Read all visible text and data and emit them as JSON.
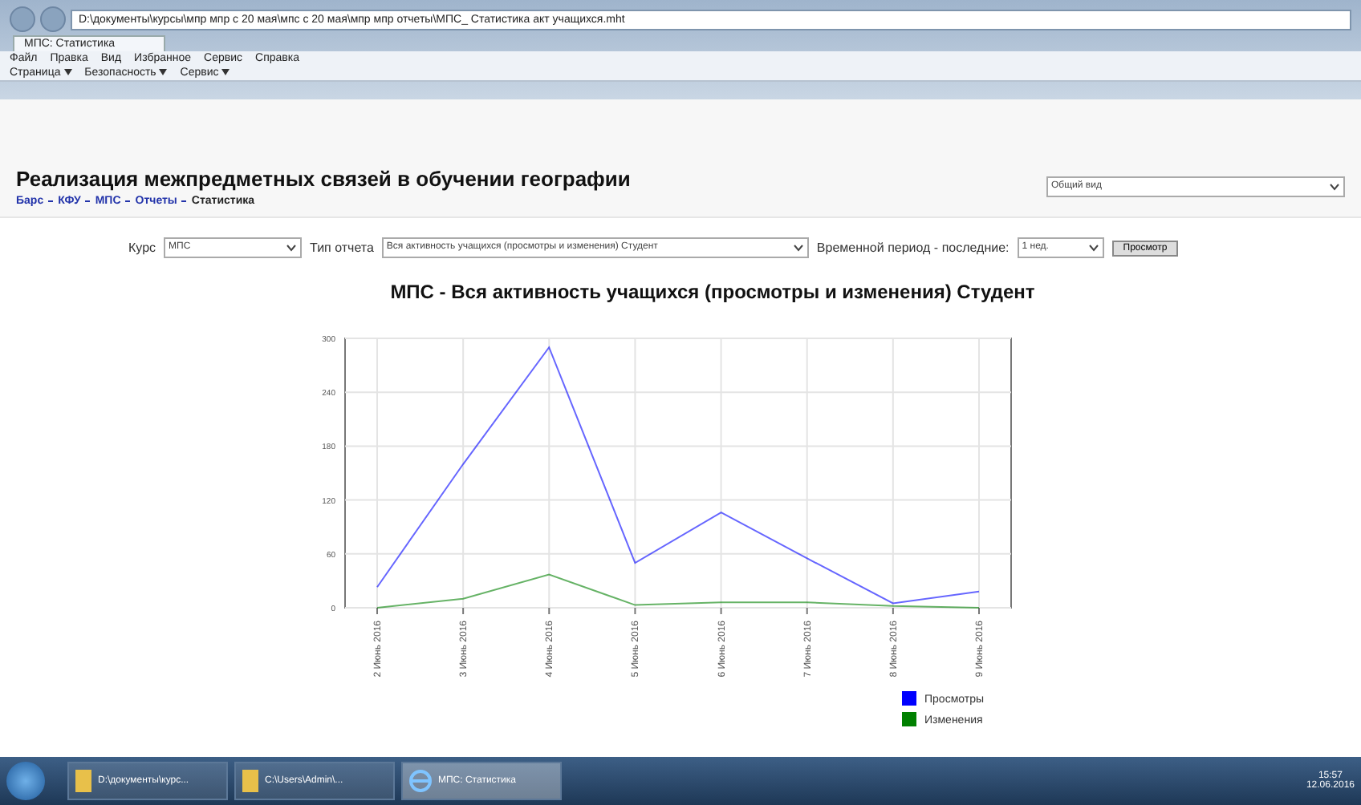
{
  "browser": {
    "address": "D:\\документы\\курсы\\мпр мпр с 20 мая\\мпс с 20 мая\\мпр мпр отчеты\\МПС_ Статистика акт учащихся.mht",
    "tab": "МПС: Статистика",
    "menu": [
      "Файл",
      "Правка",
      "Вид",
      "Избранное",
      "Сервис",
      "Справка"
    ],
    "commands": [
      "Страница",
      "Безопасность",
      "Сервис"
    ]
  },
  "page": {
    "title": "Реализация межпредметных связей в обучении географии",
    "view_select": "Общий вид",
    "breadcrumbs": [
      "Барс",
      "КФУ",
      "МПС",
      "Отчеты",
      "Статистика"
    ]
  },
  "filters": [
    {
      "label": "Курс",
      "value": "МПС",
      "kind": "select"
    },
    {
      "label": "Тип отчета",
      "value": "Вся активность учащихся (просмотры и изменения) Студент",
      "kind": "select"
    },
    {
      "label": "Временной период - последние:",
      "value": "1 нед.",
      "kind": "select"
    },
    {
      "label": "Просмотр",
      "kind": "button"
    }
  ],
  "report": {
    "title": "МПС - Вся активность учащихся (просмотры и изменения) Студент",
    "chart_data": {
      "type": "line",
      "grid": true,
      "legend": true,
      "categories": [
        "2 Июнь 2016",
        "3 Июнь 2016",
        "4 Июнь 2016",
        "5 Июнь 2016",
        "6 Июнь 2016",
        "7 Июнь 2016",
        "8 Июнь 2016",
        "9 Июнь 2016"
      ],
      "ylim": [
        0,
        300
      ],
      "yticks": [
        0,
        60,
        120,
        180,
        240,
        300
      ],
      "series": [
        {
          "name": "Просмотры",
          "color": "#0000ff",
          "values": [
            23,
            160,
            290,
            50,
            106,
            55,
            5,
            18
          ]
        },
        {
          "name": "Изменения",
          "color": "#008000",
          "values": [
            0,
            10,
            37,
            3,
            6,
            6,
            2,
            0
          ]
        }
      ]
    }
  },
  "taskbar": {
    "items": [
      {
        "label": "D:\\документы\\курс...",
        "kind": "folder",
        "selected": false
      },
      {
        "label": "C:\\Users\\Admin\\...",
        "kind": "folder",
        "selected": false
      },
      {
        "label": "МПС: Статистика",
        "kind": "browser",
        "selected": true
      }
    ],
    "time": "15:57",
    "date": "12.06.2016"
  }
}
